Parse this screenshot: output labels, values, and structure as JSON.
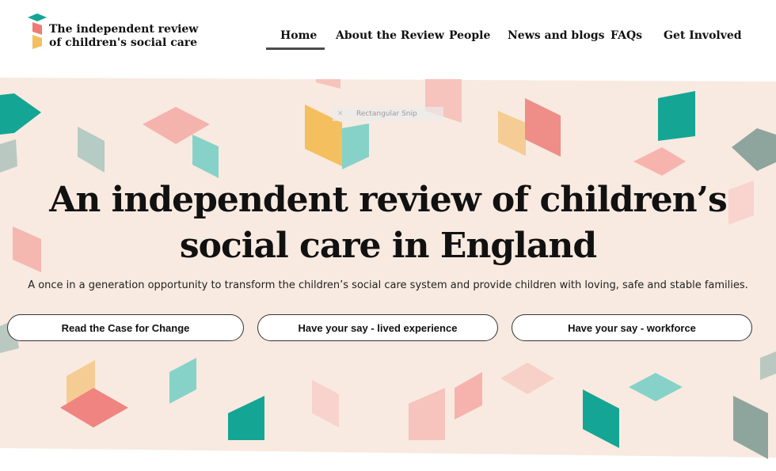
{
  "logo": {
    "line1": "The independent review",
    "line2": "of children's social care"
  },
  "nav": {
    "items": [
      {
        "label": "Home",
        "active": true
      },
      {
        "label": "About the Review",
        "active": false
      },
      {
        "label": "People",
        "active": false
      },
      {
        "label": "News and blogs",
        "active": false
      },
      {
        "label": "FAQs",
        "active": false
      },
      {
        "label": "Get Involved",
        "active": false
      }
    ]
  },
  "hero": {
    "headline_line1": "An independent review of children’s",
    "headline_line2": "social care in England",
    "tagline": "A once in a generation opportunity to transform the children’s social care system and provide children with loving, safe and stable families.",
    "buttons": [
      {
        "label": "Read the Case for Change"
      },
      {
        "label": "Have your say - lived experience"
      },
      {
        "label": "Have your say - workforce"
      }
    ],
    "snip_overlay": "Rectangular Snip"
  },
  "colors": {
    "hero_background": "#f8eae0",
    "teal": "#1aa89a",
    "pink": "#f5a9a3",
    "coral": "#ef7b77",
    "yellow": "#f4bf5f",
    "sage": "#8fa8a0",
    "light_teal": "#7ecfc6"
  }
}
